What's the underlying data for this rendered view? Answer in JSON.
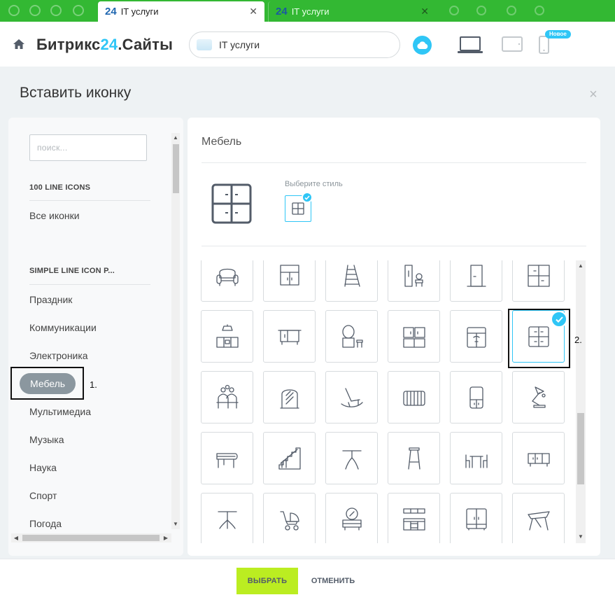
{
  "browser": {
    "tabs": [
      {
        "favicon": "24",
        "title": "IT услуги",
        "active": true,
        "close": "✕"
      },
      {
        "favicon": "24",
        "title": "IT услуги",
        "active": false,
        "close": "✕"
      }
    ]
  },
  "header": {
    "logo_main": "Битрикс",
    "logo_24": "24",
    "logo_suffix": ".Сайты",
    "site_name": "IT услуги",
    "new_badge": "Новое"
  },
  "modal": {
    "title": "Вставить иконку",
    "close": "×"
  },
  "sidebar": {
    "search_placeholder": "поиск...",
    "group1_title": "100 LINE ICONS",
    "group1_items": [
      "Все иконки"
    ],
    "group2_title": "SIMPLE LINE ICON P...",
    "group2_items": [
      "Праздник",
      "Коммуникации",
      "Электроника",
      "Мебель",
      "Мультимедиа",
      "Музыка",
      "Наука",
      "Спорт",
      "Погода"
    ],
    "selected_item": "Мебель",
    "annotation_1": "1."
  },
  "main": {
    "category_title": "Мебель",
    "style_label": "Выберите стиль",
    "annotation_2": "2.",
    "icons": [
      "armchair-icon",
      "cabinet-icon",
      "ladder-icon",
      "locker-chair-icon",
      "door-icon",
      "shelf-icon",
      "kitchen-icon",
      "dresser-icon",
      "vanity-icon",
      "cupboard-icon",
      "wardrobe-icon",
      "cabinet-doors-icon",
      "family-sofa-icon",
      "mirror-icon",
      "rocking-chair-icon",
      "radiator-icon",
      "fridge-icon",
      "desk-lamp-icon",
      "piano-icon",
      "stairs-icon",
      "round-table-icon",
      "bar-stool-icon",
      "dining-table-icon",
      "sideboard-icon",
      "side-table-icon",
      "stroller-icon",
      "mirror-dresser-icon",
      "kitchen-set-icon",
      "double-wardrobe-icon",
      "drafting-table-icon"
    ],
    "selected_icon_index": 11
  },
  "footer": {
    "choose": "ВЫБРАТЬ",
    "cancel": "ОТМЕНИТЬ"
  },
  "colors": {
    "accent": "#2fc6f6",
    "choose_button": "#bbed21",
    "browser_tabbar": "#33b833"
  }
}
